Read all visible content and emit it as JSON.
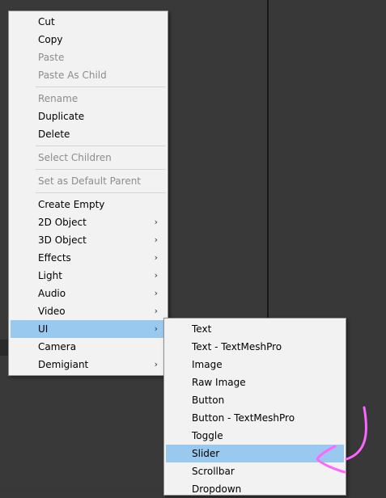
{
  "context_menu": {
    "groups": [
      [
        {
          "label": "Cut",
          "enabled": true
        },
        {
          "label": "Copy",
          "enabled": true
        },
        {
          "label": "Paste",
          "enabled": false
        },
        {
          "label": "Paste As Child",
          "enabled": false
        }
      ],
      [
        {
          "label": "Rename",
          "enabled": false
        },
        {
          "label": "Duplicate",
          "enabled": true
        },
        {
          "label": "Delete",
          "enabled": true
        }
      ],
      [
        {
          "label": "Select Children",
          "enabled": false
        }
      ],
      [
        {
          "label": "Set as Default Parent",
          "enabled": false
        }
      ],
      [
        {
          "label": "Create Empty",
          "enabled": true
        },
        {
          "label": "2D Object",
          "enabled": true,
          "submenu": true
        },
        {
          "label": "3D Object",
          "enabled": true,
          "submenu": true
        },
        {
          "label": "Effects",
          "enabled": true,
          "submenu": true
        },
        {
          "label": "Light",
          "enabled": true,
          "submenu": true
        },
        {
          "label": "Audio",
          "enabled": true,
          "submenu": true
        },
        {
          "label": "Video",
          "enabled": true,
          "submenu": true
        },
        {
          "label": "UI",
          "enabled": true,
          "submenu": true,
          "highlighted": true
        },
        {
          "label": "Camera",
          "enabled": true
        },
        {
          "label": "Demigiant",
          "enabled": true,
          "submenu": true
        }
      ]
    ],
    "submenu_arrow": "›"
  },
  "ui_submenu": {
    "items": [
      {
        "label": "Text"
      },
      {
        "label": "Text - TextMeshPro"
      },
      {
        "label": "Image"
      },
      {
        "label": "Raw Image"
      },
      {
        "label": "Button"
      },
      {
        "label": "Button - TextMeshPro"
      },
      {
        "label": "Toggle"
      },
      {
        "label": "Slider",
        "highlighted": true
      },
      {
        "label": "Scrollbar"
      },
      {
        "label": "Dropdown"
      }
    ]
  },
  "colors": {
    "menu_background": "#f2f2f2",
    "highlight": "#99c9ef",
    "disabled_text": "#8c8c8c",
    "annotation_arrow": "#ff66ff"
  },
  "icons": {
    "annotation": "hand-drawn-arrow-icon"
  }
}
